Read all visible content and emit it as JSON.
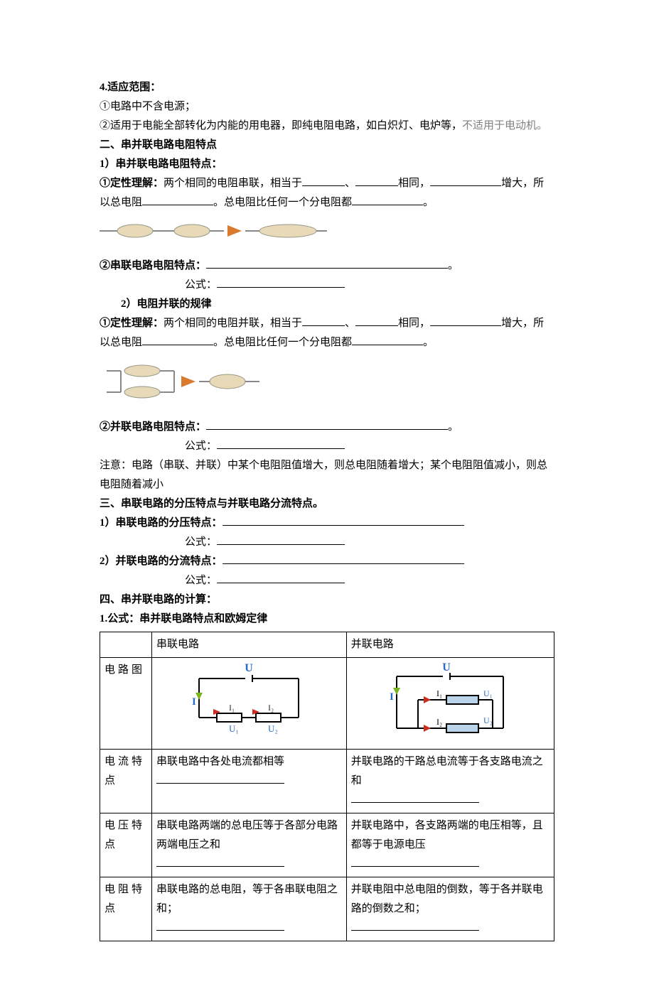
{
  "s4_title": "4.适应范围：",
  "s4_p1": "①电路中不含电源；",
  "s4_p2a": "②适用于电能全部转化为内能的用电器，即纯电阻电路，如白炽灯、电炉等，",
  "s4_p2b": "不适用于电动机。",
  "sec2_title": "二、串并联电路电阻特点",
  "sec2_1_title": "1）串并联电路电阻特点：",
  "sec2_1_1a": "①定性理解：",
  "sec2_1_1b": "两个相同的电阻串联，相当于",
  "sec2_1_1c": "、",
  "sec2_1_1d": "相同，",
  "sec2_1_1e": "增大，所以总电阻",
  "sec2_1_1f": "。总电阻比任何一个分电阻都",
  "sec2_1_1g": "。",
  "sec2_1_2a": "②串联电路电阻特点：",
  "sec2_1_2b": "。",
  "sec2_1_2_formula": "公式：",
  "sec2_2_title": "2）电阻并联的规律",
  "sec2_2_1a": "①定性理解：",
  "sec2_2_1b": "两个相同的电阻并联，相当于",
  "sec2_2_1c": "、",
  "sec2_2_1d": "相同，",
  "sec2_2_1e": "增大，所以总电阻",
  "sec2_2_1f": "。总电阻比任何一个分电阻都",
  "sec2_2_1g": "。",
  "sec2_2_2a": "②并联电路电阻特点：",
  "sec2_2_2b": "。",
  "sec2_2_2_formula": "公式：",
  "note": "注意：电路（串联、并联）中某个电阻阻值增大，则总电阻随着增大；某个电阻阻值减小，则总电阻随着减小",
  "sec3_title": "三、串联电路的分压特点与并联电路分流特点。",
  "sec3_1": "1）串联电路的分压特点：",
  "sec3_1_formula": "公式：",
  "sec3_2": "2）并联电路的分流特点：",
  "sec3_2_formula": "公式：",
  "sec4_title": "四、串并联电路的计算：",
  "sec4_1": "1.公式：串并联电路特点和欧姆定律",
  "tbl": {
    "hdr_series": "串联电路",
    "hdr_parallel": "并联电路",
    "row_diagram": "电路图",
    "row_current": "电流特点",
    "row_voltage": "电压特点",
    "row_resist": "电阻特点",
    "series_current": "串联电路中各处电流都相等",
    "parallel_current": "并联电路的干路总电流等于各支路电流之和",
    "series_voltage": "串联电路两端的总电压等于各部分电路两端电压之和",
    "parallel_voltage": "并联电路中，各支路两端的电压相等，且都等于电源电压",
    "series_resist": "串联电路的总电阻，等于各串联电阻之和；",
    "parallel_resist": "并联电阻中总电阻的倒数，等于各并联电路的倒数之和；"
  },
  "circ": {
    "U": "U",
    "I": "I",
    "I1": "I₁",
    "I2": "I₂",
    "U1": "U₁",
    "U2": "U₂"
  }
}
